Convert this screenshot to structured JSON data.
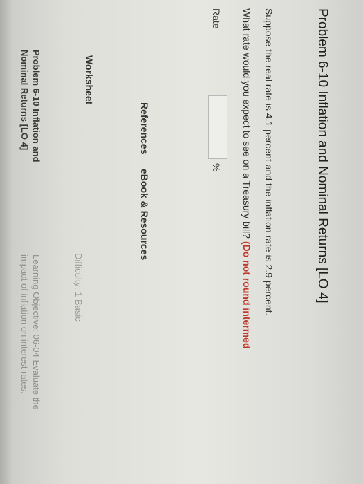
{
  "title": "Problem 6-10 Inflation and Nominal Returns [LO 4]",
  "question": {
    "line1": "Suppose the real rate is 4.1 percent and the inflation rate is 2.9 percent.",
    "line2": "What rate would you expect to see on a Treasury bill?",
    "warning": "(Do not round intermed"
  },
  "answer": {
    "label": "Rate",
    "value": "",
    "unit": "%"
  },
  "tabs": {
    "references": "References",
    "ebook": "eBook & Resources"
  },
  "worksheet": {
    "label": "Worksheet",
    "difficulty": "Difficulty: 1 Basic",
    "problem_ref_line1": "Problem 6-10 Inflation and",
    "problem_ref_line2": "Nominal Returns [LO 4]",
    "learning_objective_line1": "Learning Objective: 06-04 Evaluate the",
    "learning_objective_line2": "impact of inflation on interest rates."
  }
}
